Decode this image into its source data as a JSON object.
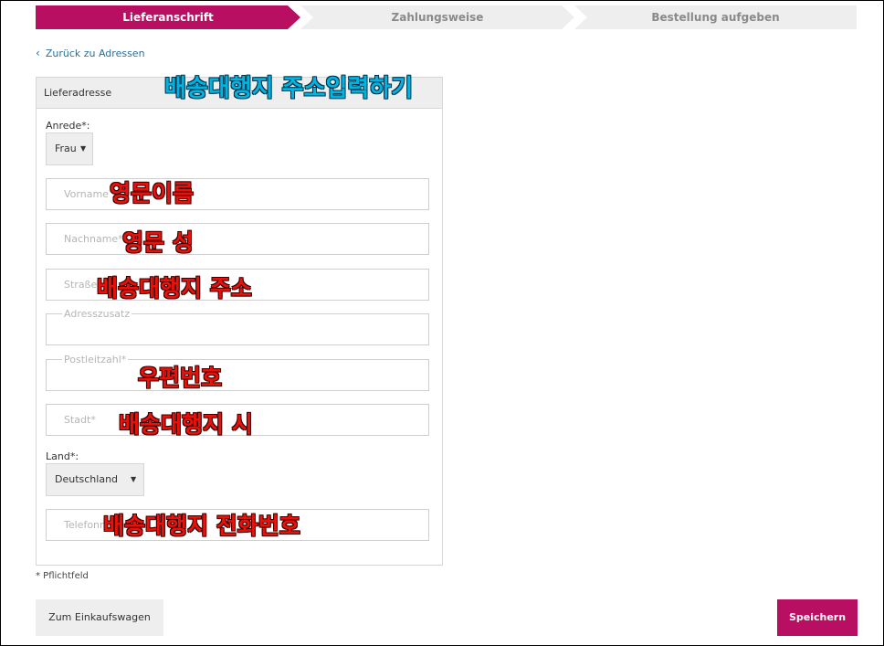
{
  "steps": [
    {
      "label": "Lieferanschrift",
      "active": true
    },
    {
      "label": "Zahlungsweise",
      "active": false
    },
    {
      "label": "Bestellung aufgeben",
      "active": false
    }
  ],
  "back_link": "Zurück zu Adressen",
  "panel_title": "Lieferadresse",
  "form": {
    "salutation_label": "Anrede*:",
    "salutation_value": "Frau",
    "firstname_placeholder": "Vorname *",
    "lastname_placeholder": "Nachname*",
    "street_placeholder": "Straße",
    "address_extra_placeholder": "Adresszusatz",
    "zip_placeholder": "Postleitzahl*",
    "city_placeholder": "Stadt*",
    "country_label": "Land*:",
    "country_value": "Deutschland",
    "phone_placeholder": "Telefonnummer"
  },
  "annotations": {
    "title": "배송대행지 주소입력하기",
    "firstname": "영문이름",
    "lastname": "영문 성",
    "street": "배송대행지 주소",
    "zip": "우편번호",
    "city": "배송대행지 시",
    "phone": "배송대행지 전화번호"
  },
  "required_note": "* Pflichtfeld",
  "buttons": {
    "cart": "Zum Einkaufswagen",
    "save": "Speichern"
  },
  "colors": {
    "accent": "#b80f63",
    "inactive_step": "#eeeeee",
    "link": "#2a6f97",
    "annotation_red": "#e8120b",
    "annotation_blue": "#00b4e2"
  }
}
